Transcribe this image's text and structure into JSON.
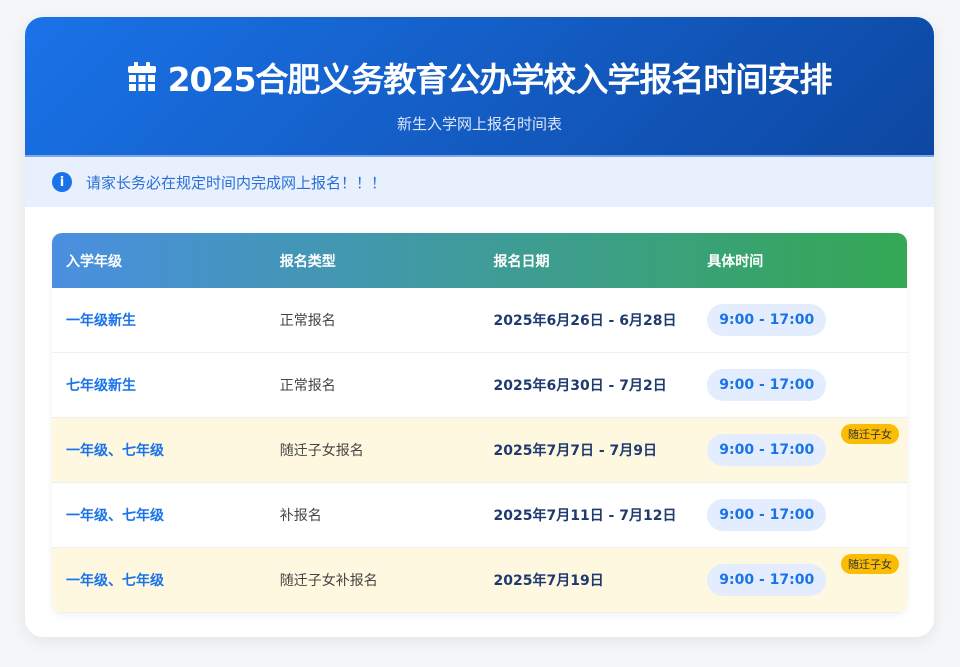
{
  "header": {
    "title": "2025合肥义务教育公办学校入学报名时间安排",
    "subtitle": "新生入学网上报名时间表"
  },
  "notice": {
    "text": "请家长务必在规定时间内完成网上报名！！！"
  },
  "table": {
    "columns": [
      "入学年级",
      "报名类型",
      "报名日期",
      "具体时间"
    ],
    "rows": [
      {
        "grade": "一年级新生",
        "type": "正常报名",
        "date": "2025年6月26日 - 6月28日",
        "time": "9:00 - 17:00",
        "badge": null
      },
      {
        "grade": "七年级新生",
        "type": "正常报名",
        "date": "2025年6月30日 - 7月2日",
        "time": "9:00 - 17:00",
        "badge": null
      },
      {
        "grade": "一年级、七年级",
        "type": "随迁子女报名",
        "date": "2025年7月7日 - 7月9日",
        "time": "9:00 - 17:00",
        "badge": "随迁子女"
      },
      {
        "grade": "一年级、七年级",
        "type": "补报名",
        "date": "2025年7月11日 - 7月12日",
        "time": "9:00 - 17:00",
        "badge": null
      },
      {
        "grade": "一年级、七年级",
        "type": "随迁子女补报名",
        "date": "2025年7月19日",
        "time": "9:00 - 17:00",
        "badge": "随迁子女"
      }
    ]
  },
  "colors": {
    "header_start": "#1a73e8",
    "header_end": "#0d47a1",
    "highlight_row": "#fff8e1",
    "badge": "#fbbc04"
  }
}
